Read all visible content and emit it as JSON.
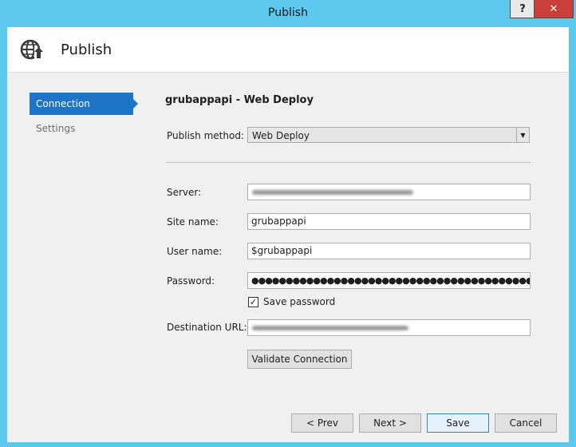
{
  "window": {
    "title": "Publish",
    "help_label": "?",
    "close_label": "✕"
  },
  "header": {
    "icon": "globe-publish-icon",
    "title": "Publish"
  },
  "nav": {
    "items": [
      {
        "label": "Connection",
        "active": true
      },
      {
        "label": "Settings",
        "active": false
      }
    ]
  },
  "page": {
    "title": "grubappapi - Web Deploy",
    "publish_method": {
      "label": "Publish method:",
      "value": "Web Deploy"
    },
    "server": {
      "label": "Server:",
      "value": ""
    },
    "site_name": {
      "label": "Site name:",
      "value": "grubappapi"
    },
    "user_name": {
      "label": "User name:",
      "value": "$grubappapi"
    },
    "password": {
      "label": "Password:",
      "value": "●●●●●●●●●●●●●●●●●●●●●●●●●●●●●●●●●●●●●●●●●●●●●●●●●●●●●●●●"
    },
    "save_password": {
      "label": "Save password",
      "checked": true
    },
    "destination_url": {
      "label": "Destination URL:",
      "value": ""
    },
    "validate_label": "Validate Connection"
  },
  "footer": {
    "prev_label": "< Prev",
    "next_label": "Next >",
    "save_label": "Save",
    "cancel_label": "Cancel"
  }
}
